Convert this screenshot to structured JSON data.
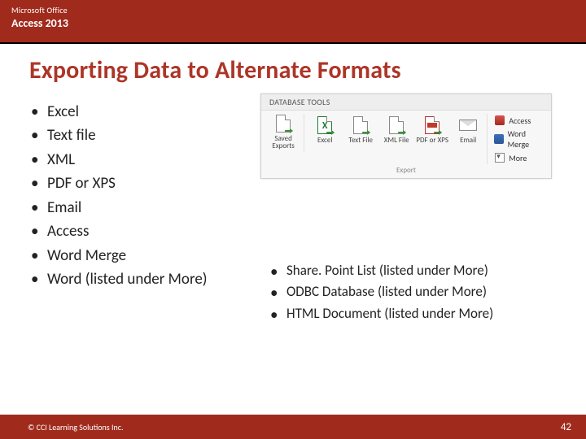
{
  "header": {
    "brand": "Microsoft Office",
    "product": "Access 2013"
  },
  "title": "Exporting Data to Alternate Formats",
  "left_bullets": [
    "Excel",
    "Text file",
    "XML",
    "PDF or XPS",
    "Email",
    "Access",
    "Word Merge",
    "Word (listed under More)"
  ],
  "right_bullets": [
    "Share. Point List (listed under More)",
    "ODBC Database (listed under More)",
    "HTML Document (listed under More)"
  ],
  "ribbon": {
    "tab": "DATABASE TOOLS",
    "saved": "Saved Exports",
    "buttons": [
      "Excel",
      "Text File",
      "XML File",
      "PDF or XPS",
      "Email"
    ],
    "side": [
      "Access",
      "Word Merge",
      "More"
    ],
    "group": "Export"
  },
  "footer": {
    "copyright": "© CCI Learning Solutions Inc.",
    "page": "42"
  }
}
